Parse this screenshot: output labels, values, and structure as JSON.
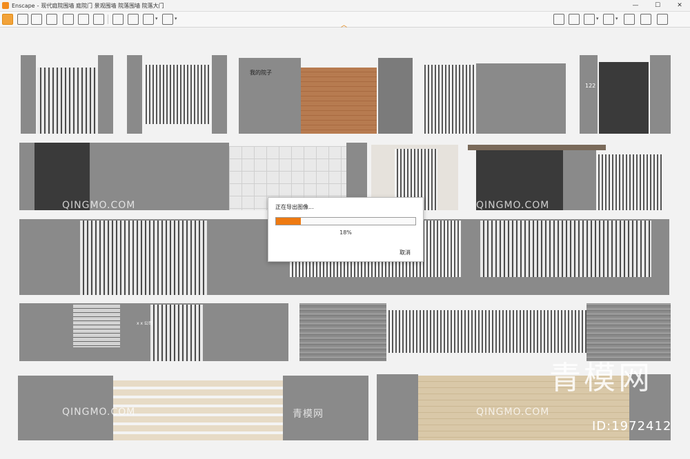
{
  "window": {
    "app_name": "Enscape",
    "title": "现代庭院围墙 庭院门 景观围墙 院落围墙 院落大门",
    "minimize": "—",
    "maximize": "☐",
    "close": "✕"
  },
  "toolbar": {
    "icons_left": [
      "home-icon",
      "link-icon",
      "bim-icon",
      "binoculars-icon",
      "paint-icon",
      "map-icon",
      "building-icon",
      "site-icon",
      "panorama-icon",
      "screenshot-icon",
      "batch-export-icon",
      "video-icon"
    ],
    "icons_right": [
      "map-icon",
      "monitor-icon",
      "asset-library-icon",
      "cube-icon",
      "book-icon",
      "box-icon",
      "settings-icon",
      "help-icon"
    ],
    "collapse_glyph": "︿"
  },
  "scene": {
    "plate_text": "我的院子",
    "house_number": "122",
    "small_sign": "x x 公司",
    "watermark_latin": "QINGMO.COM",
    "watermark_cn": "青模网",
    "watermark_big": "青模网",
    "id_label": "ID:1972412"
  },
  "export_dialog": {
    "title": "正在导出图像...",
    "progress_percent": 18,
    "percent_label": "18%",
    "cancel_label": "取消"
  }
}
